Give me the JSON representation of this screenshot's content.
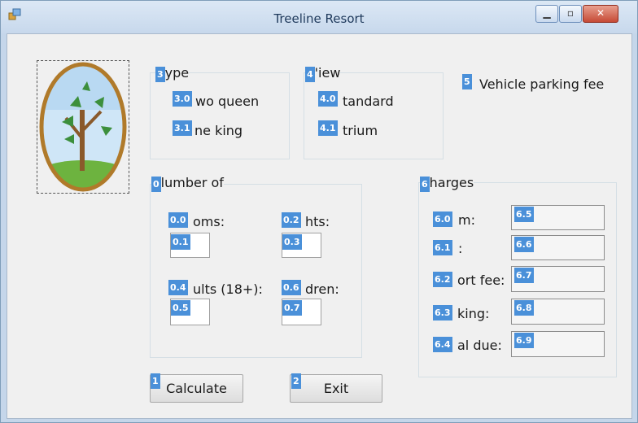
{
  "window": {
    "title": "Treeline Resort",
    "minimize_icon": "minimize-icon",
    "maximize_icon": "maximize-icon",
    "close_icon": "close-icon"
  },
  "type_group": {
    "tag": "3",
    "label": "ype",
    "options": [
      {
        "tag": "3.0",
        "label": "wo queen"
      },
      {
        "tag": "3.1",
        "label": "ne king"
      }
    ]
  },
  "view_group": {
    "tag": "4",
    "label": "'iew",
    "options": [
      {
        "tag": "4.0",
        "label": "tandard"
      },
      {
        "tag": "4.1",
        "label": "trium"
      }
    ]
  },
  "parking": {
    "tag": "5",
    "label": "Vehicle parking fee"
  },
  "number_group": {
    "tag": "0",
    "label": "lumber of",
    "rooms": {
      "tag": "0.0",
      "label": "oms:",
      "box_tag": "0.1"
    },
    "nights": {
      "tag": "0.2",
      "label": "hts:",
      "box_tag": "0.3"
    },
    "adults": {
      "tag": "0.4",
      "label": "ults (18+):",
      "box_tag": "0.5"
    },
    "children": {
      "tag": "0.6",
      "label": "dren:",
      "box_tag": "0.7"
    }
  },
  "charges_group": {
    "tag": "6",
    "label": "harges",
    "rows": [
      {
        "tag": "6.0",
        "label": "m:",
        "box_tag": "6.5"
      },
      {
        "tag": "6.1",
        "label": ":",
        "box_tag": "6.6"
      },
      {
        "tag": "6.2",
        "label": "ort fee:",
        "box_tag": "6.7"
      },
      {
        "tag": "6.3",
        "label": "king:",
        "box_tag": "6.8"
      },
      {
        "tag": "6.4",
        "label": "al due:",
        "box_tag": "6.9"
      }
    ]
  },
  "buttons": {
    "calculate": {
      "tag": "1",
      "label": "Calculate"
    },
    "exit": {
      "tag": "2",
      "label": "Exit"
    }
  },
  "colors": {
    "tag_blue": "#4a90d9",
    "title_text": "#1e395b"
  },
  "image": {
    "icon": "tree-logo-icon"
  }
}
